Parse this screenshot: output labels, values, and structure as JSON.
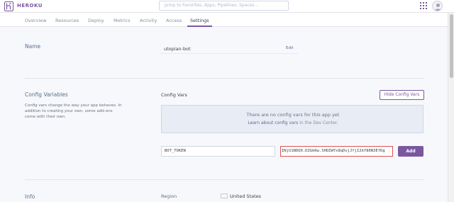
{
  "header": {
    "logo_text": "HEROKU",
    "search_placeholder": "Jump to Favorites, Apps, Pipelines, Spaces..."
  },
  "tabs": [
    {
      "label": "Overview"
    },
    {
      "label": "Resources"
    },
    {
      "label": "Deploy"
    },
    {
      "label": "Metrics"
    },
    {
      "label": "Activity"
    },
    {
      "label": "Access"
    },
    {
      "label": "Settings"
    }
  ],
  "active_tab": "Settings",
  "name_section": {
    "title": "Name",
    "value": "utopian-bot",
    "edit_label": "Edit"
  },
  "config_section": {
    "title": "Config Variables",
    "description": "Config vars change the way your app behaves. In addition to creating your own, some add-ons come with their own.",
    "subtitle": "Config Vars",
    "hide_button": "Hide Config Vars",
    "empty_title": "There are no config vars for this app yet",
    "empty_link": "Learn about config vars",
    "empty_suffix": " in the Dev Center.",
    "key_value": "BOT_TOKEN",
    "val_value": "INjU1NDQ0.DZGkKw.SHQIWYx8qDvjJfjI2kY80N3EfDg",
    "add_button": "Add"
  },
  "info_section": {
    "title": "Info",
    "region_label": "Region",
    "region_value": "United States"
  },
  "colors": {
    "accent": "#79589f",
    "error_border": "#d9534f",
    "empty_bg": "#e7ecf5"
  },
  "icons": {
    "logo": "heroku-logo-icon",
    "apps": "apps-grid-icon",
    "avatar": "user-avatar-icon",
    "flag": "us-flag-icon"
  }
}
